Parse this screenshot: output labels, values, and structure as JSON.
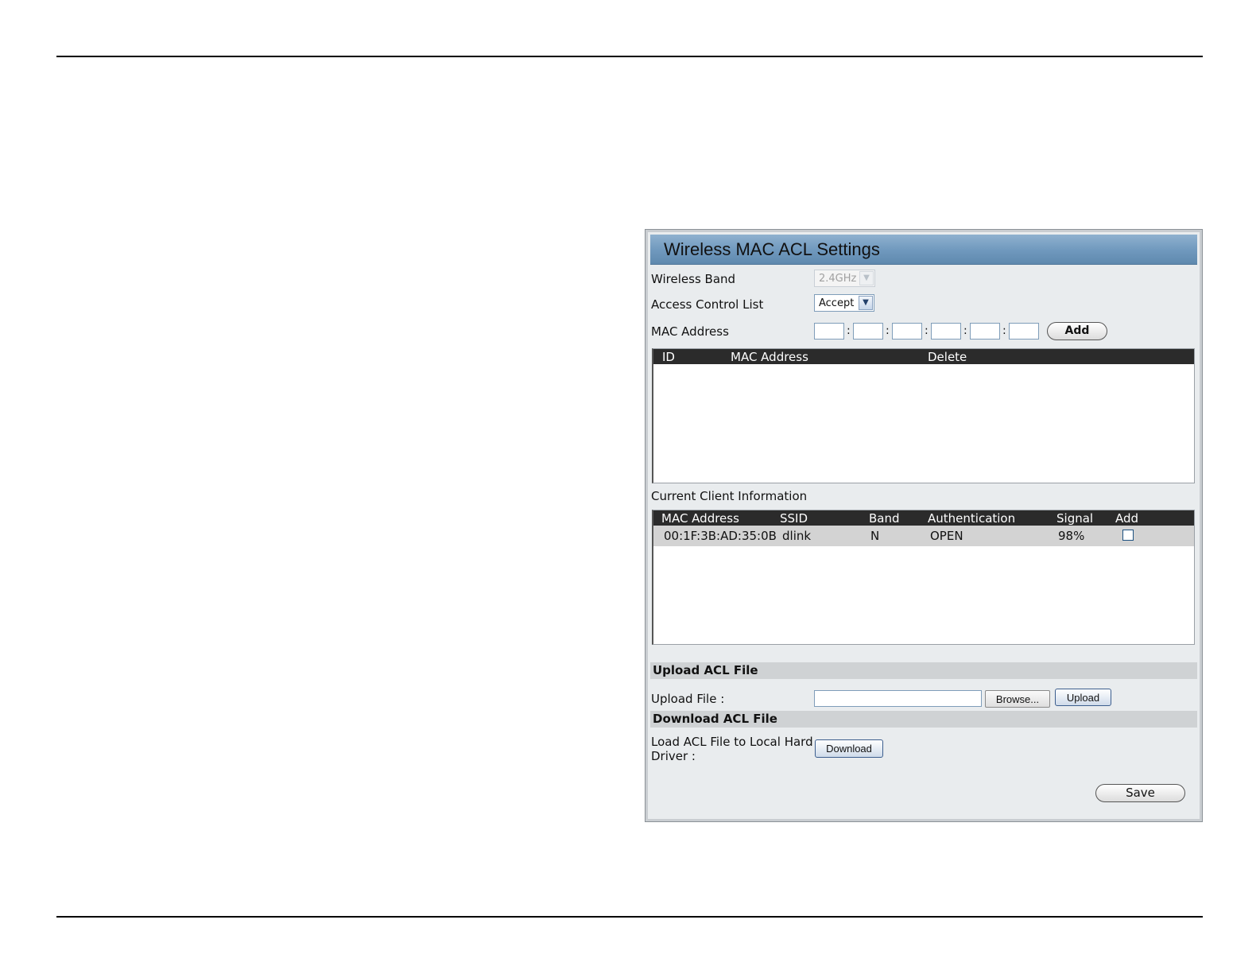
{
  "panel": {
    "title": "Wireless MAC ACL Settings",
    "wireless_band": {
      "label": "Wireless Band",
      "value": "2.4GHz"
    },
    "access_control_list": {
      "label": "Access Control List",
      "value": "Accept"
    },
    "mac_address": {
      "label": "MAC Address",
      "separator": ":",
      "add_label": "Add"
    },
    "acl_table": {
      "columns": [
        "ID",
        "MAC Address",
        "Delete"
      ],
      "rows": []
    },
    "client_info": {
      "title": "Current Client Information",
      "columns": [
        "MAC Address",
        "SSID",
        "Band",
        "Authentication",
        "Signal",
        "Add"
      ],
      "rows": [
        {
          "mac": "00:1F:3B:AD:35:0B",
          "ssid": "dlink",
          "band": "N",
          "auth": "OPEN",
          "signal": "98%"
        }
      ]
    },
    "upload": {
      "section_title": "Upload ACL File",
      "label": "Upload File :",
      "browse_label": "Browse...",
      "upload_label": "Upload"
    },
    "download": {
      "section_title": "Download ACL File",
      "label_line1": "Load ACL File to Local Hard",
      "label_line2": "Driver :",
      "download_label": "Download"
    },
    "save_label": "Save"
  }
}
